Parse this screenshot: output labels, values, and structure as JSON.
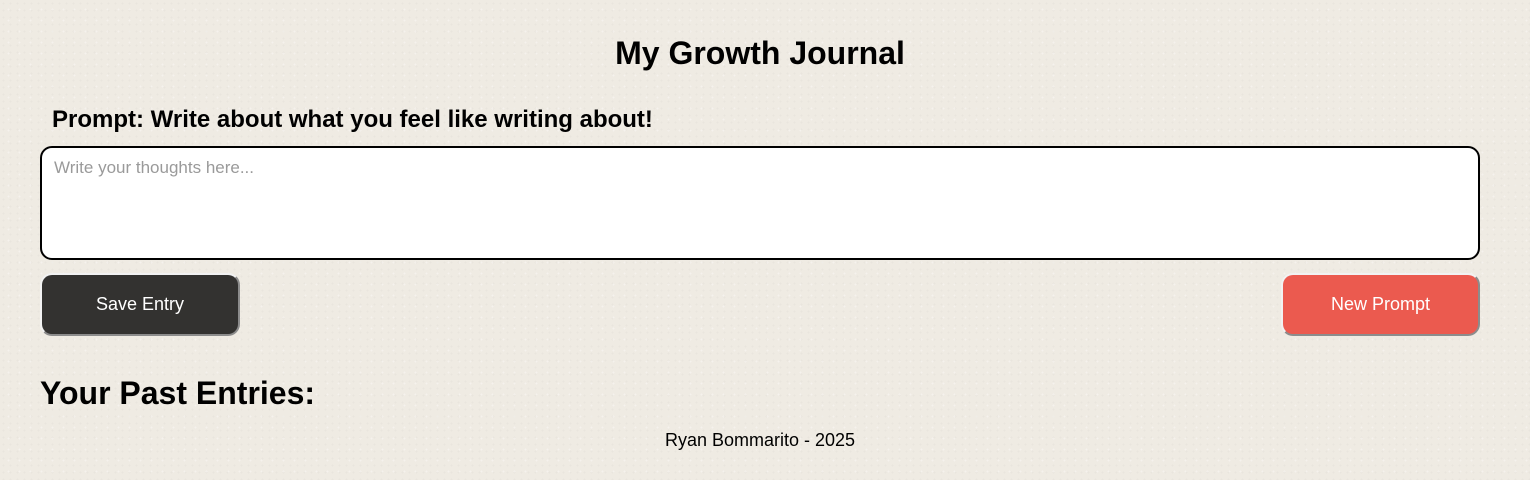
{
  "header": {
    "title": "My Growth Journal"
  },
  "prompt": {
    "text": "Prompt: Write about what you feel like writing about!"
  },
  "entry": {
    "value": "",
    "placeholder": "Write your thoughts here..."
  },
  "actions": {
    "save_label": "Save Entry",
    "new_prompt_label": "New Prompt"
  },
  "past_entries": {
    "heading": "Your Past Entries:",
    "items": []
  },
  "footer": {
    "text": "Ryan Bommarito - 2025"
  },
  "colors": {
    "background": "#efebe3",
    "save_button": "#333230",
    "new_prompt_button": "#eb5a4f"
  }
}
